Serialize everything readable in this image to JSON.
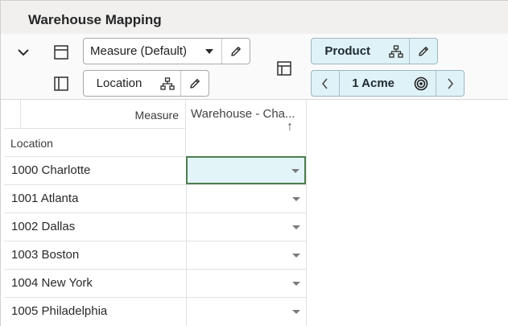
{
  "window": {
    "title": "Warehouse Mapping"
  },
  "toolbar": {
    "measure_select": {
      "value": "Measure (Default)"
    },
    "location_chip": {
      "label": "Location"
    },
    "product_chip": {
      "label": "Product"
    },
    "page_nav": {
      "value": "1 Acme"
    }
  },
  "grid": {
    "corner_measure_label": "Measure",
    "corner_location_label": "Location",
    "column_header": "Warehouse - Cha...",
    "sort_indicator": "↑",
    "rows": [
      {
        "label": "1000 Charlotte",
        "value": ""
      },
      {
        "label": "1001 Atlanta",
        "value": ""
      },
      {
        "label": "1002 Dallas",
        "value": ""
      },
      {
        "label": "1003 Boston",
        "value": ""
      },
      {
        "label": "1004 New York",
        "value": ""
      },
      {
        "label": "1005 Philadelphia",
        "value": ""
      }
    ]
  },
  "colors": {
    "selected_cell_bg": "#e3f4f9",
    "selected_cell_border": "#4d7e4f",
    "chip_blue_bg": "#dff2f7",
    "title_bar_bg": "#f1f0ef"
  }
}
